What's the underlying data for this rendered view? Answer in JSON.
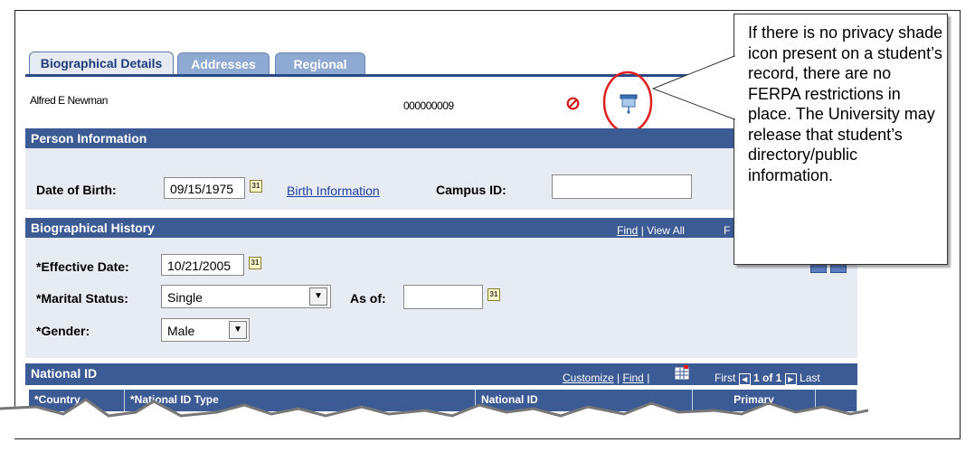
{
  "tabs": [
    {
      "label": "Biographical Details",
      "active": true
    },
    {
      "label": "Addresses",
      "active": false
    },
    {
      "label": "Regional",
      "active": false
    }
  ],
  "person": {
    "name": "Alfred E Newman",
    "id": "000000009"
  },
  "icons": {
    "no_entry": "no-entry-icon",
    "privacy_shade": "privacy-shade-icon",
    "calendar": "calendar-icon"
  },
  "person_information": {
    "title": "Person Information",
    "dob_label": "Date of Birth:",
    "dob_value": "09/15/1975",
    "birth_info_link": "Birth Information",
    "campus_id_label": "Campus ID:",
    "campus_id_value": ""
  },
  "biographical_history": {
    "title": "Biographical History",
    "find_label": "Find",
    "view_all_label": "View All",
    "first_label": "F",
    "effective_date_label": "*Effective Date:",
    "effective_date_value": "10/21/2005",
    "marital_status_label": "*Marital Status:",
    "marital_status_value": "Single",
    "as_of_label": "As of:",
    "as_of_value": "",
    "gender_label": "*Gender:",
    "gender_value": "Male"
  },
  "national_id": {
    "title": "National ID",
    "customize_label": "Customize",
    "find_label": "Find",
    "pager": {
      "first": "First",
      "range": "1 of 1",
      "last": "Last"
    },
    "columns": [
      "*Country",
      "*National ID Type",
      "National ID",
      "Primary"
    ]
  },
  "calendar_glyph": "31",
  "callout": {
    "text": "If there is no privacy shade icon present on a student’s record, there are no FERPA restrictions in place.  The University may release that student’s directory/public information."
  },
  "colors": {
    "header_bar": "#3c5a94",
    "panel_bg": "#e7ebf2",
    "highlight_circle": "#e02020",
    "link": "#1f3fa0"
  }
}
